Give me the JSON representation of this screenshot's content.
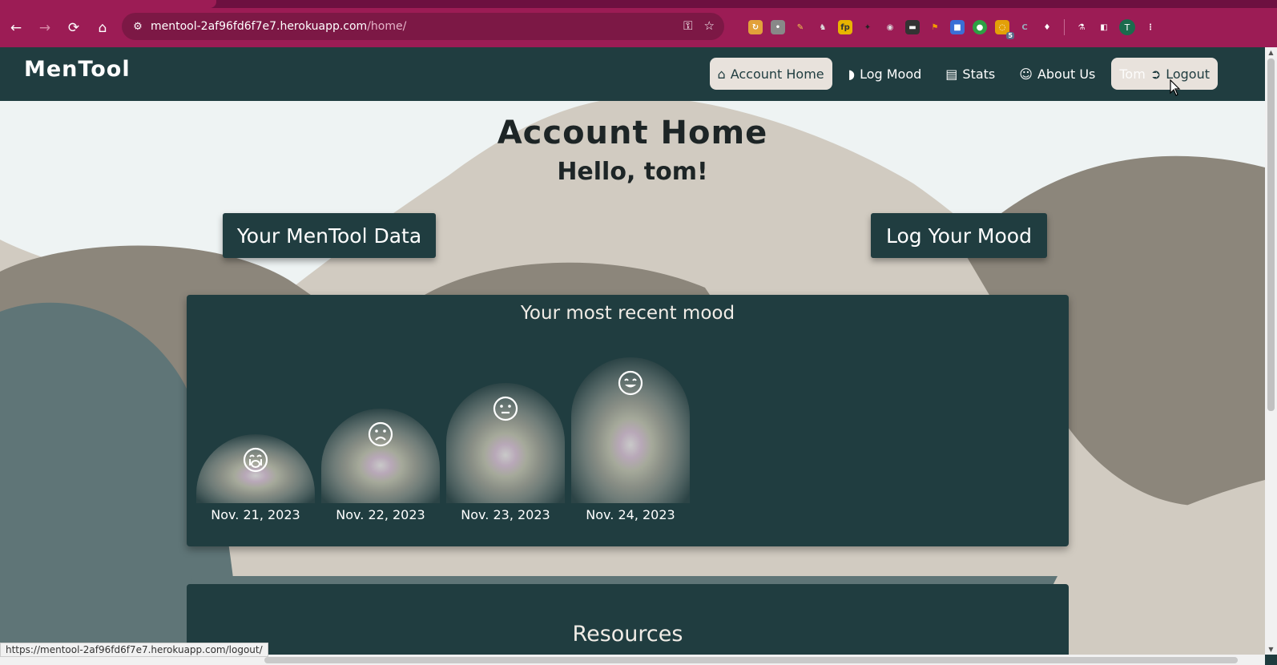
{
  "browser": {
    "url_host": "mentool-2af96fd6f7e7.herokuapp.com",
    "url_path": "/home/",
    "status_url": "https://mentool-2af96fd6f7e7.herokuapp.com/logout/",
    "profile_initial": "T",
    "extension_badge": "5",
    "icons": [
      "back-icon",
      "forward-icon",
      "reload-icon",
      "home-icon",
      "site-info-icon",
      "key-icon",
      "star-icon",
      "extensions-icon",
      "labs-icon",
      "side-panel-icon",
      "menu-icon"
    ]
  },
  "nav": {
    "brand": "MenTool",
    "items": [
      {
        "label": "Account Home",
        "icon": "house-icon"
      },
      {
        "label": "Log Mood",
        "icon": "brain-icon"
      },
      {
        "label": "Stats",
        "icon": "bar-chart-icon"
      },
      {
        "label": "About Us",
        "icon": "users-icon"
      }
    ],
    "user": "Tom",
    "logout": "Logout"
  },
  "page": {
    "title": "Account Home",
    "greeting": "Hello, tom!",
    "data_button": "Your MenTool Data",
    "log_button": "Log Your Mood"
  },
  "recent_mood": {
    "title": "Your most recent mood",
    "entries": [
      {
        "date": "Nov. 21, 2023",
        "face": "crying-face-icon",
        "level": 1
      },
      {
        "date": "Nov. 22, 2023",
        "face": "sad-face-icon",
        "level": 2
      },
      {
        "date": "Nov. 23, 2023",
        "face": "neutral-face-icon",
        "level": 3
      },
      {
        "date": "Nov. 24, 2023",
        "face": "happy-face-icon",
        "level": 4
      }
    ]
  },
  "resources": {
    "title": "Resources"
  },
  "colors": {
    "brand": "#203d40",
    "chrome": "#9c1c55",
    "accent_light": "#e8e2dc"
  }
}
